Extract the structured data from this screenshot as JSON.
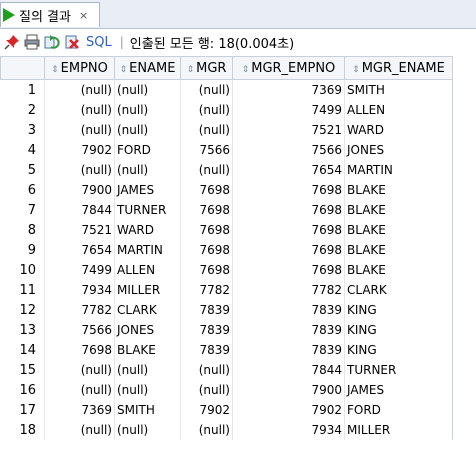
{
  "tab": {
    "title": "질의 결과",
    "close": "×"
  },
  "toolbar": {
    "sql_label": "SQL",
    "separator": "|",
    "status": "인출된 모든 행: 18(0.004초)",
    "icons": [
      "pin-icon",
      "print-icon",
      "refresh-icon",
      "export-icon"
    ]
  },
  "grid": {
    "sort_glyph": "⇕",
    "columns": [
      "EMPNO",
      "ENAME",
      "MGR",
      "MGR_EMPNO",
      "MGR_ENAME"
    ],
    "rows": [
      [
        "1",
        "(null)",
        "(null)",
        "(null)",
        "7369",
        "SMITH"
      ],
      [
        "2",
        "(null)",
        "(null)",
        "(null)",
        "7499",
        "ALLEN"
      ],
      [
        "3",
        "(null)",
        "(null)",
        "(null)",
        "7521",
        "WARD"
      ],
      [
        "4",
        "7902",
        "FORD",
        "7566",
        "7566",
        "JONES"
      ],
      [
        "5",
        "(null)",
        "(null)",
        "(null)",
        "7654",
        "MARTIN"
      ],
      [
        "6",
        "7900",
        "JAMES",
        "7698",
        "7698",
        "BLAKE"
      ],
      [
        "7",
        "7844",
        "TURNER",
        "7698",
        "7698",
        "BLAKE"
      ],
      [
        "8",
        "7521",
        "WARD",
        "7698",
        "7698",
        "BLAKE"
      ],
      [
        "9",
        "7654",
        "MARTIN",
        "7698",
        "7698",
        "BLAKE"
      ],
      [
        "10",
        "7499",
        "ALLEN",
        "7698",
        "7698",
        "BLAKE"
      ],
      [
        "11",
        "7934",
        "MILLER",
        "7782",
        "7782",
        "CLARK"
      ],
      [
        "12",
        "7782",
        "CLARK",
        "7839",
        "7839",
        "KING"
      ],
      [
        "13",
        "7566",
        "JONES",
        "7839",
        "7839",
        "KING"
      ],
      [
        "14",
        "7698",
        "BLAKE",
        "7839",
        "7839",
        "KING"
      ],
      [
        "15",
        "(null)",
        "(null)",
        "(null)",
        "7844",
        "TURNER"
      ],
      [
        "16",
        "(null)",
        "(null)",
        "(null)",
        "7900",
        "JAMES"
      ],
      [
        "17",
        "7369",
        "SMITH",
        "7902",
        "7902",
        "FORD"
      ],
      [
        "18",
        "(null)",
        "(null)",
        "(null)",
        "7934",
        "MILLER"
      ]
    ]
  },
  "colors": {
    "play": "#1ea01e",
    "sql": "#2a62c9",
    "header_bg": "#f4f6fa"
  }
}
